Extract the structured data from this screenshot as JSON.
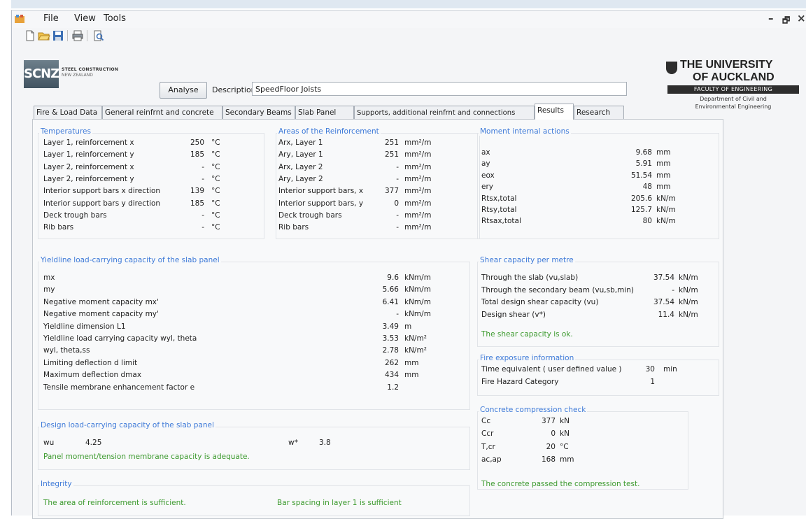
{
  "menu": {
    "file": "File",
    "view": "View",
    "tools": "Tools"
  },
  "window_controls": {
    "minimize": "–",
    "maximize": "🗗",
    "close": "×"
  },
  "logo": {
    "name": "SCNZ",
    "line1": "STEEL CONSTRUCTION",
    "line2": "NEW ZEALAND"
  },
  "header": {
    "analyse_label": "Analyse",
    "description_label": "Description",
    "description_value": "SpeedFloor Joists"
  },
  "university": {
    "line1": "THE UNIVERSITY",
    "line2": "OF AUCKLAND",
    "faculty": "FACULTY OF ENGINEERING",
    "dept1": "Department of Civil and",
    "dept2": "Environmental Engineering"
  },
  "tabs": [
    "Fire & Load Data",
    "General reinfrnt and concrete",
    "Secondary Beams",
    "Slab Panel",
    "Supports, additional reinfrnt and connections",
    "Results",
    "Research"
  ],
  "active_tab": "Results",
  "temperatures": {
    "title": "Temperatures",
    "rows": [
      {
        "label": "Layer 1, reinforcement x",
        "value": "250",
        "unit": "°C"
      },
      {
        "label": "Layer 1, reinforcement y",
        "value": "185",
        "unit": "°C"
      },
      {
        "label": "Layer 2, reinforcement x",
        "value": "-",
        "unit": "°C"
      },
      {
        "label": "Layer 2, reinforcement y",
        "value": "-",
        "unit": "°C"
      },
      {
        "label": "Interior support bars x direction",
        "value": "139",
        "unit": "°C"
      },
      {
        "label": "Interior support bars y direction",
        "value": "185",
        "unit": "°C"
      },
      {
        "label": "Deck trough bars",
        "value": "-",
        "unit": "°C"
      },
      {
        "label": "Rib bars",
        "value": "-",
        "unit": "°C"
      }
    ]
  },
  "areas": {
    "title": "Areas of the Reinforcement",
    "rows": [
      {
        "label": "Arx, Layer 1",
        "value": "251",
        "unit": "mm²/m"
      },
      {
        "label": "Ary, Layer 1",
        "value": "251",
        "unit": "mm²/m"
      },
      {
        "label": "Arx, Layer 2",
        "value": "-",
        "unit": "mm²/m"
      },
      {
        "label": "Ary, Layer 2",
        "value": "-",
        "unit": "mm²/m"
      },
      {
        "label": "Interior support bars, x",
        "value": "377",
        "unit": "mm²/m"
      },
      {
        "label": "Interior support bars, y",
        "value": "0",
        "unit": "mm²/m"
      },
      {
        "label": "Deck trough bars",
        "value": "-",
        "unit": "mm²/m"
      },
      {
        "label": "Rib bars",
        "value": "-",
        "unit": "mm²/m"
      }
    ]
  },
  "moments": {
    "title": "Moment internal actions",
    "rows": [
      {
        "label": "ax",
        "value": "9.68",
        "unit": "mm"
      },
      {
        "label": "ay",
        "value": "5.91",
        "unit": "mm"
      },
      {
        "label": "eox",
        "value": "51.54",
        "unit": "mm"
      },
      {
        "label": "ery",
        "value": "48",
        "unit": "mm"
      },
      {
        "label": "Rtsx,total",
        "value": "205.6",
        "unit": "kN/m"
      },
      {
        "label": "Rtsy,total",
        "value": "125.7",
        "unit": "kN/m"
      },
      {
        "label": "Rtsax,total",
        "value": "80",
        "unit": "kN/m"
      }
    ]
  },
  "yieldline": {
    "title": "Yieldline load-carrying capacity of the slab panel",
    "rows": [
      {
        "label": "mx",
        "value": "9.6",
        "unit": "kNm/m"
      },
      {
        "label": "my",
        "value": "5.66",
        "unit": "kNm/m"
      },
      {
        "label": "Negative moment capacity mx'",
        "value": "6.41",
        "unit": "kNm/m"
      },
      {
        "label": "Negative moment capacity my'",
        "value": "-",
        "unit": "kNm/m"
      },
      {
        "label": "Yieldline dimension L1",
        "value": "3.49",
        "unit": "m"
      },
      {
        "label": "Yieldline load carrying capacity  wyl, theta",
        "value": "3.53",
        "unit": "kN/m²"
      },
      {
        "label": "wyl, theta,ss",
        "value": "2.78",
        "unit": "kN/m²"
      },
      {
        "label": "Limiting deflection d limit",
        "value": "262",
        "unit": "mm"
      },
      {
        "label": "Maximum deflection dmax",
        "value": "434",
        "unit": "mm"
      },
      {
        "label": "Tensile membrane enhancement factor e",
        "value": "1.2",
        "unit": ""
      }
    ]
  },
  "shear": {
    "title": "Shear capacity per metre",
    "rows": [
      {
        "label": "Through the slab (vu,slab)",
        "value": "37.54",
        "unit": "kN/m"
      },
      {
        "label": "Through the secondary beam (vu,sb,min)",
        "value": "-",
        "unit": "kN/m"
      },
      {
        "label": "Total design shear capacity (vu)",
        "value": "37.54",
        "unit": "kN/m"
      },
      {
        "label": "Design shear (v*)",
        "value": "11.4",
        "unit": "kN/m"
      }
    ],
    "status": "The shear capacity is ok."
  },
  "fire": {
    "title": "Fire exposure information",
    "rows": [
      {
        "label": "Time equivalent ( user defined value )",
        "value": "30",
        "unit": "min"
      },
      {
        "label": "Fire Hazard Category",
        "value": "1",
        "unit": ""
      }
    ]
  },
  "concrete": {
    "title": "Concrete compression check",
    "rows": [
      {
        "label": "Cc",
        "value": "377",
        "unit": "kN"
      },
      {
        "label": "Ccr",
        "value": "0",
        "unit": "kN"
      },
      {
        "label": "T,cr",
        "value": "20",
        "unit": "°C"
      },
      {
        "label": "ac,ap",
        "value": "168",
        "unit": "mm"
      }
    ],
    "status": "The concrete passed the compression test."
  },
  "design": {
    "title": "Design load-carrying capacity of the slab panel",
    "wu_label": "wu",
    "wu_value": "4.25",
    "wstar_label": "w*",
    "wstar_value": "3.8",
    "status": "Panel moment/tension membrane capacity is adequate."
  },
  "integrity": {
    "title": "Integrity",
    "status1": "The area of reinforcement is sufficient.",
    "status2": "Bar spacing in layer 1 is sufficient"
  }
}
